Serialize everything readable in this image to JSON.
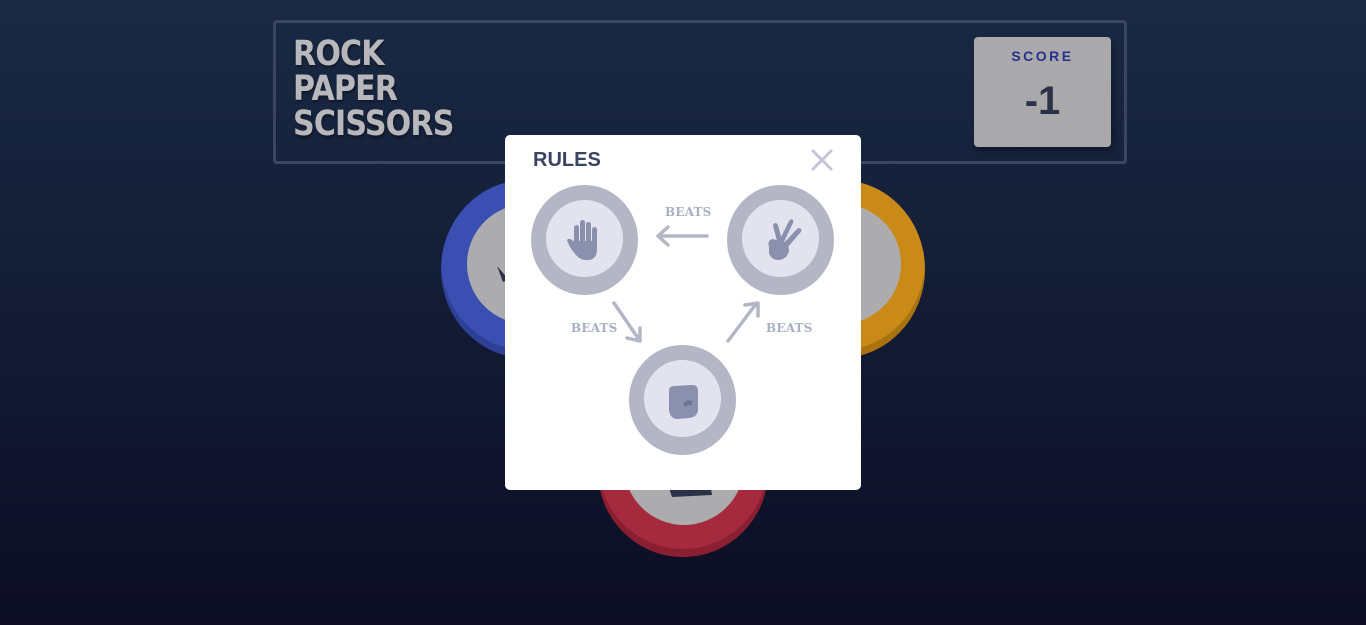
{
  "header": {
    "title_lines": [
      "ROCK",
      "PAPER",
      "SCISSORS"
    ],
    "score_label": "SCORE",
    "score_value": "-1"
  },
  "rules_modal": {
    "title": "RULES",
    "close_icon": "close-icon",
    "beats_labels": [
      "BEATS",
      "BEATS",
      "BEATS"
    ],
    "choices": [
      "paper",
      "scissors",
      "rock"
    ]
  },
  "colors": {
    "paper": "#3b4fb3",
    "scissors": "#c98a18",
    "rock": "#a62a3d",
    "rule_chip": "#b4b6c6",
    "icon": "#8b90ad"
  }
}
